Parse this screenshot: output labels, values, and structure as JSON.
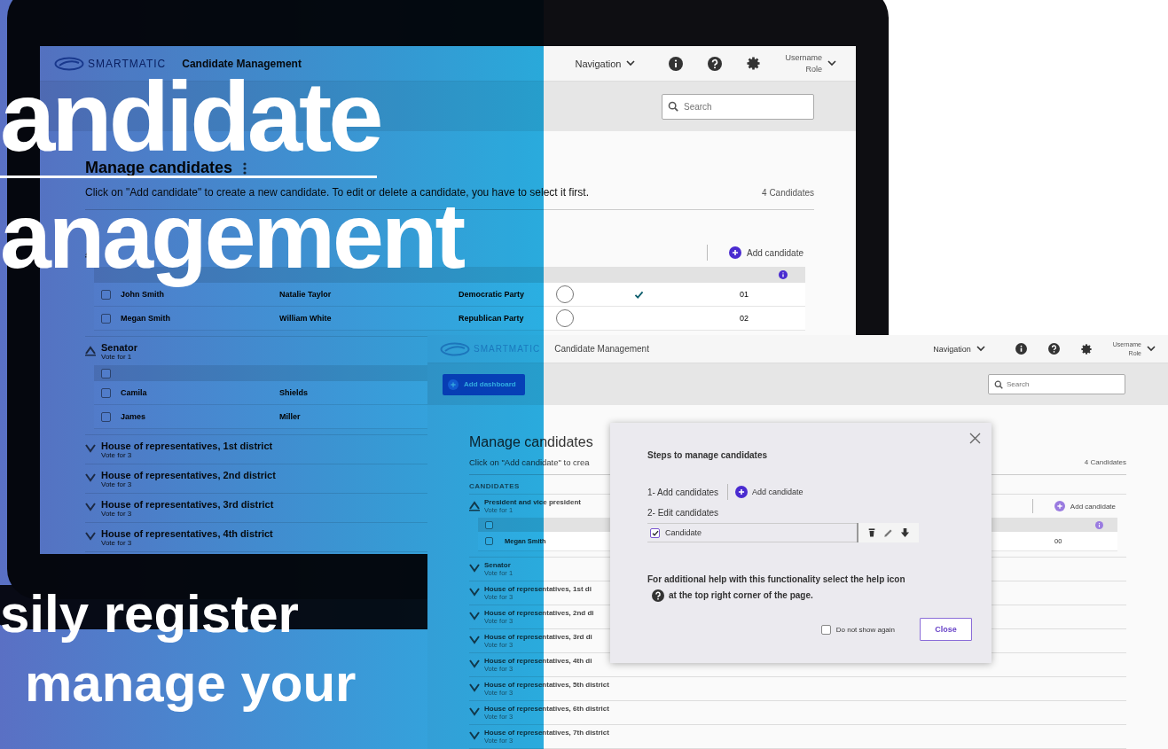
{
  "headline": {
    "lines": [
      "andidate",
      "anagement"
    ]
  },
  "tagline": {
    "lines": [
      "sily register",
      "manage your"
    ]
  },
  "laptop_screen": {
    "header": {
      "logo": "SMARTMATIC",
      "title": "Candidate Management",
      "navigation": "Navigation",
      "username": "Username",
      "role": "Role"
    },
    "search": {
      "placeholder": "Search"
    },
    "title": "Manage candidates",
    "instructions": "Click on \"Add candidate\" to create a new candidate. To edit or delete a candidate, you have to select it first.",
    "count": "4 Candidates",
    "groups": [
      {
        "expanded": true,
        "add_label": "Add candidate",
        "rows": [
          {
            "checked": false,
            "name": "John Smith",
            "running_mate": "Natalie Taylor",
            "party": "Democratic Party",
            "photo": true,
            "marked": true,
            "number": "01"
          },
          {
            "checked": false,
            "name": "Megan Smith",
            "running_mate": "William White",
            "party": "Republican Party",
            "photo": true,
            "marked": false,
            "number": "02"
          }
        ]
      },
      {
        "title": "Senator",
        "subtitle": "Vote for 1",
        "expanded": true,
        "select_all_checked": false,
        "rows": [
          {
            "checked": false,
            "name": "Camila",
            "running_mate": "Shields"
          },
          {
            "checked": false,
            "name": "James",
            "running_mate": "Miller"
          }
        ]
      },
      {
        "title": "House of representatives, 1st district",
        "subtitle": "Vote for 3",
        "expanded": false
      },
      {
        "title": "House of representatives, 2nd district",
        "subtitle": "Vote for 3",
        "expanded": false
      },
      {
        "title": "House of representatives, 3rd district",
        "subtitle": "Vote for 3",
        "expanded": false
      },
      {
        "title": "House of representatives, 4th district",
        "subtitle": "Vote for 3",
        "expanded": false
      }
    ]
  },
  "front_screen": {
    "header": {
      "logo": "SMARTMATIC",
      "title": "Candidate Management",
      "navigation": "Navigation",
      "username": "Username",
      "role": "Role"
    },
    "toolbar_button": "Add dashboard",
    "search": {
      "placeholder": "Search"
    },
    "title": "Manage candidates",
    "instructions": "Click on \"Add candidate\" to crea",
    "count": "4 Candidates",
    "section_label": "CANDIDATES",
    "groups": [
      {
        "title": "President and vice president",
        "subtitle": "Vote for 1",
        "expanded": true,
        "add_label": "Add candidate",
        "select_all_checked": false,
        "rows": [
          {
            "checked": false,
            "name": "Megan Smith",
            "number": "00"
          }
        ]
      },
      {
        "title": "Senator",
        "subtitle": "Vote for 1",
        "expanded": false
      },
      {
        "title": "House of representatives, 1st di",
        "subtitle": "Vote for 3",
        "expanded": false
      },
      {
        "title": "House of representatives, 2nd di",
        "subtitle": "Vote for 3",
        "expanded": false
      },
      {
        "title": "House of representatives, 3rd di",
        "subtitle": "Vote for 3",
        "expanded": false
      },
      {
        "title": "House of representatives, 4th di",
        "subtitle": "Vote for 3",
        "expanded": false
      },
      {
        "title": "House of representatives, 5th district",
        "subtitle": "Vote for 3",
        "expanded": false
      },
      {
        "title": "House of representatives, 6th district",
        "subtitle": "Vote for 3",
        "expanded": false
      },
      {
        "title": "House of representatives, 7th district",
        "subtitle": "Vote for 3",
        "expanded": false
      }
    ],
    "dialog": {
      "title": "Steps to manage candidates",
      "step_1": "1- Add candidates",
      "add_label": "Add candidate",
      "step_2": "2- Edit candidates",
      "example_row": {
        "label": "Candidate",
        "checked": true
      },
      "help_before": "For additional help with this functionality select the help icon",
      "help_after": "at the top right corner of the page.",
      "dont_show": {
        "label": "Do not show again",
        "checked": false
      },
      "close_button": "Close"
    }
  }
}
